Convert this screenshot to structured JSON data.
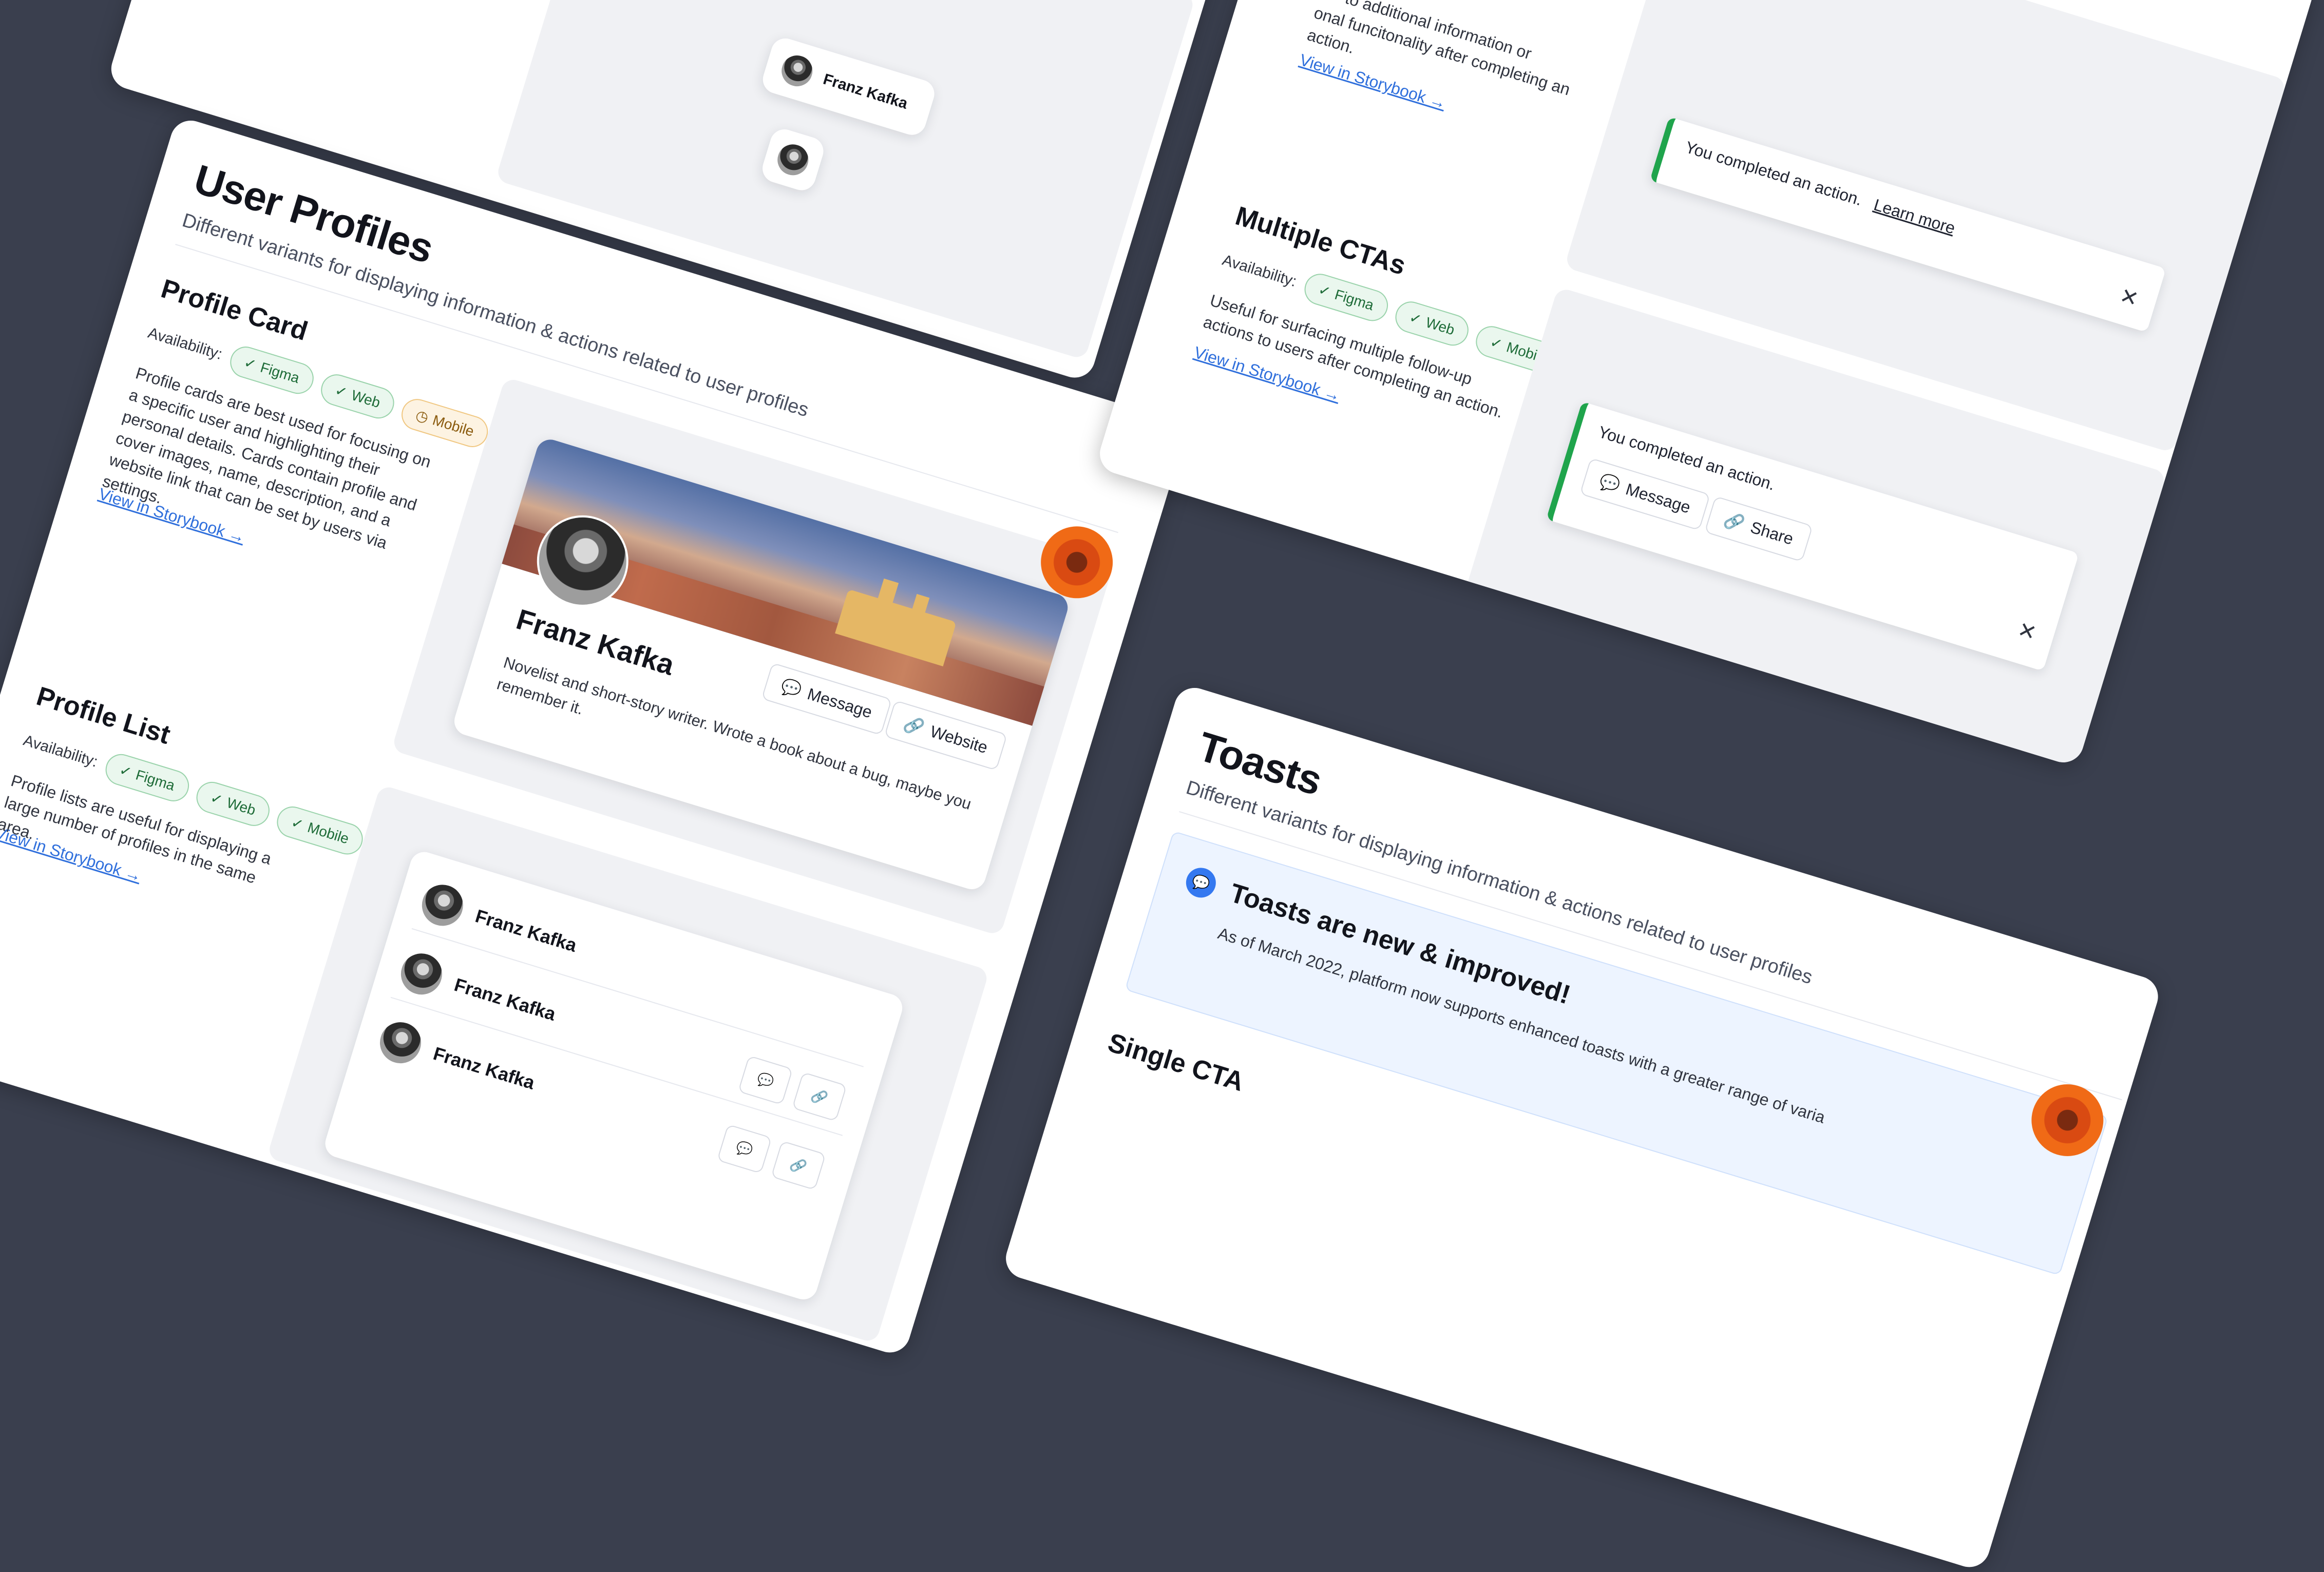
{
  "user_profiles": {
    "title": "User Profiles",
    "subtitle": "Different variants for displaying information & actions related to user profiles",
    "profile_card": {
      "heading": "Profile Card",
      "availability_label": "Availability:",
      "badges": [
        "Figma",
        "Web",
        "Mobile"
      ],
      "description": "Profile cards are best used for focusing on a specific user and highlighting their personal details. Cards contain profile and cover images, name, description, and a website link that can be set by users via settings.",
      "storybook_link": "View in Storybook →",
      "card": {
        "name": "Franz Kafka",
        "bio": "Novelist and short-story writer. Wrote a book about a bug, maybe you remember it.",
        "message_label": "Message",
        "website_label": "Website"
      }
    },
    "profile_list": {
      "heading": "Profile List",
      "availability_label": "Availability:",
      "badges": [
        "Figma",
        "Web",
        "Mobile"
      ],
      "description": "Profile lists are useful for displaying a large number of profiles in the same area.",
      "storybook_link": "View in Storybook →",
      "items": [
        "Franz Kafka",
        "Franz Kafka",
        "Franz Kafka"
      ]
    },
    "top_chip_name": "Franz Kafka"
  },
  "toasts_top": {
    "fragment_line1": "to additional information or",
    "fragment_line2": "onal funcitonality after completing an",
    "fragment_line3": "action.",
    "storybook_link": "View in Storybook →",
    "toast_learn": {
      "text": "You completed an action.",
      "link": "Learn more"
    },
    "multiple_ctas": {
      "heading": "Multiple CTAs",
      "availability_label": "Availability:",
      "badges": [
        "Figma",
        "Web",
        "Mobile"
      ],
      "description": "Useful for surfacing multiple follow-up actions to users after completing an action.",
      "storybook_link": "View in Storybook →",
      "toast": {
        "text": "You completed an action.",
        "message_label": "Message",
        "share_label": "Share"
      }
    }
  },
  "toasts": {
    "title": "Toasts",
    "subtitle": "Different variants for displaying information & actions related to user profiles",
    "banner_title": "Toasts are new & improved!",
    "banner_text": "As of March 2022, platform now supports enhanced toasts with a greater range of varia",
    "single_cta_heading": "Single CTA"
  },
  "colors": {
    "background": "#3a3f4e",
    "accent_link": "#2f6fdc",
    "success": "#1fa44c",
    "brand_orange": "#f06a16"
  }
}
